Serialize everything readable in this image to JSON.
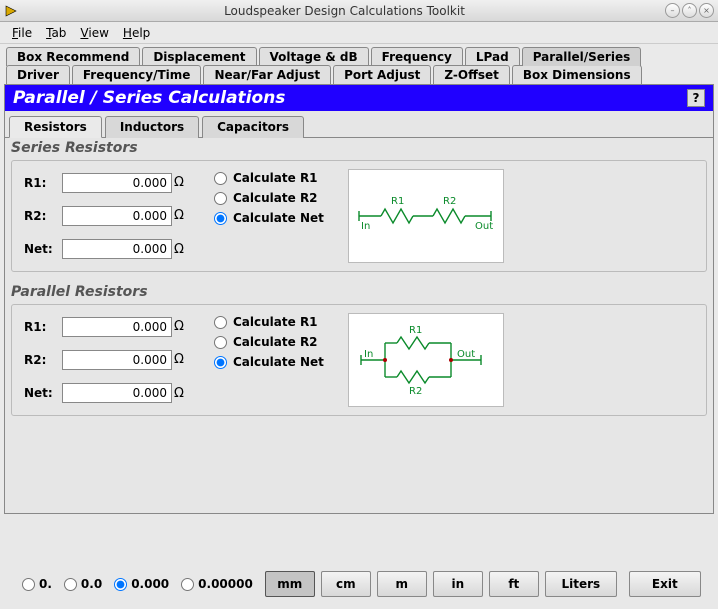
{
  "window": {
    "title": "Loudspeaker Design Calculations Toolkit"
  },
  "menu": {
    "file": "File",
    "tab": "Tab",
    "view": "View",
    "help": "Help"
  },
  "tabs_row1": [
    "Box Recommend",
    "Displacement",
    "Voltage & dB",
    "Frequency",
    "LPad",
    "Parallel/Series"
  ],
  "tabs_row2": [
    "Driver",
    "Frequency/Time",
    "Near/Far Adjust",
    "Port Adjust",
    "Z-Offset",
    "Box Dimensions"
  ],
  "tabs_active": "Parallel/Series",
  "panel": {
    "title": "Parallel / Series Calculations",
    "help": "?"
  },
  "subtabs": [
    "Resistors",
    "Inductors",
    "Capacitors"
  ],
  "subtab_active": "Resistors",
  "series": {
    "title": "Series Resistors",
    "r1_label": "R1:",
    "r1_value": "0.000",
    "r1_unit": "Ω",
    "r2_label": "R2:",
    "r2_value": "0.000",
    "r2_unit": "Ω",
    "net_label": "Net:",
    "net_value": "0.000",
    "net_unit": "Ω",
    "calc_r1": "Calculate R1",
    "calc_r2": "Calculate R2",
    "calc_net": "Calculate Net",
    "selected": "net",
    "diag": {
      "in": "In",
      "out": "Out",
      "r1": "R1",
      "r2": "R2"
    }
  },
  "parallel": {
    "title": "Parallel Resistors",
    "r1_label": "R1:",
    "r1_value": "0.000",
    "r1_unit": "Ω",
    "r2_label": "R2:",
    "r2_value": "0.000",
    "r2_unit": "Ω",
    "net_label": "Net:",
    "net_value": "0.000",
    "net_unit": "Ω",
    "calc_r1": "Calculate R1",
    "calc_r2": "Calculate R2",
    "calc_net": "Calculate Net",
    "selected": "net",
    "diag": {
      "in": "In",
      "out": "Out",
      "r1": "R1",
      "r2": "R2"
    }
  },
  "precision": {
    "p0": "0.",
    "p00": "0.0",
    "p000": "0.000",
    "p00000": "0.00000",
    "selected": "0.000"
  },
  "units": {
    "mm": "mm",
    "cm": "cm",
    "m": "m",
    "in": "in",
    "ft": "ft",
    "liters": "Liters",
    "selected": "mm"
  },
  "exit": "Exit"
}
